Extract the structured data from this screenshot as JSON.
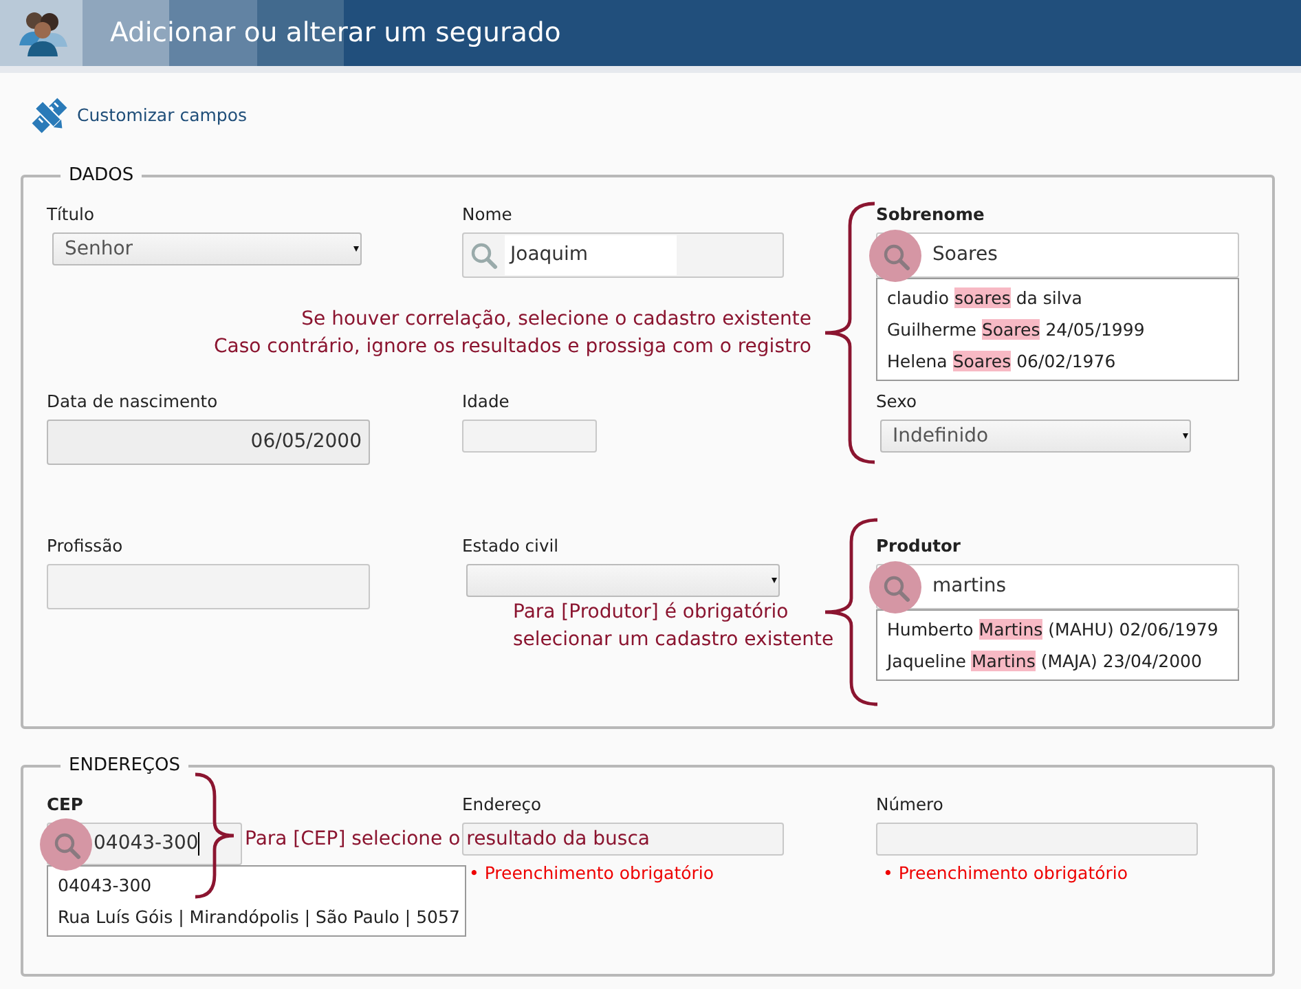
{
  "header": {
    "title": "Adicionar ou alterar um segurado"
  },
  "toolbar": {
    "link": "Customizar campos"
  },
  "sections": [
    {
      "legend": "DADOS",
      "rows": [
        [
          {
            "label": "Título",
            "bold_label": false,
            "kind": "select",
            "value": "Senhor"
          },
          {
            "label": "Nome",
            "bold_label": false,
            "kind": "search",
            "value": "Joaquim"
          },
          {
            "label": "Sobrenome",
            "bold_label": true,
            "kind": "lookup",
            "value": "Soares",
            "suggestions": [
              {
                "before": "claudio ",
                "match": "soares",
                "after": " da silva"
              },
              {
                "before": "Guilherme ",
                "match": "Soares",
                "after": " 24/05/1999"
              },
              {
                "before": "Helena ",
                "match": "Soares",
                "after": " 06/02/1976"
              }
            ]
          }
        ],
        [
          {
            "label": "Data de nascimento",
            "bold_label": false,
            "kind": "date",
            "value": "06/05/2000"
          },
          {
            "label": "Idade",
            "bold_label": false,
            "kind": "short"
          },
          {
            "label": "Sexo",
            "bold_label": false,
            "kind": "select",
            "value": "Indefinido"
          }
        ],
        [
          {
            "label": "Profissão",
            "bold_label": false,
            "kind": "text"
          },
          {
            "label": "Estado civil",
            "bold_label": false,
            "kind": "select"
          },
          {
            "label": "Produtor",
            "bold_label": true,
            "kind": "lookup",
            "value": "martins",
            "suggestions": [
              {
                "before": "Humberto ",
                "match": "Martins",
                "after": " (MAHU) 02/06/1979"
              },
              {
                "before": "Jaqueline ",
                "match": "Martins",
                "after": " (MAJA) 23/04/2000"
              }
            ]
          }
        ]
      ]
    },
    {
      "legend": "ENDEREÇOS",
      "rows": [
        [
          {
            "label": "CEP",
            "bold_label": true,
            "kind": "lookup",
            "value": "04043-300",
            "focused": true,
            "suggestions": [
              {
                "before": "04043-300"
              },
              {
                "before": "Rua Luís Góis | Mirandópolis | São Paulo | 5057"
              }
            ]
          },
          {
            "label": "Endereço",
            "bold_label": false,
            "kind": "text",
            "error": "• Preenchimento obrigatório"
          },
          {
            "label": "Número",
            "bold_label": false,
            "kind": "text",
            "error": "• Preenchimento obrigatório"
          }
        ]
      ]
    }
  ],
  "annotations": [
    {
      "lines": [
        "Se houver correlação, selecione o cadastro existente",
        "Caso contrário, ignore os resultados e prossiga com o registro"
      ]
    },
    {
      "lines": [
        "Para [Produtor] é obrigatório",
        "selecionar um cadastro existente"
      ]
    },
    {
      "lines": [
        "Para [CEP] selecione o resultado da busca"
      ]
    }
  ]
}
